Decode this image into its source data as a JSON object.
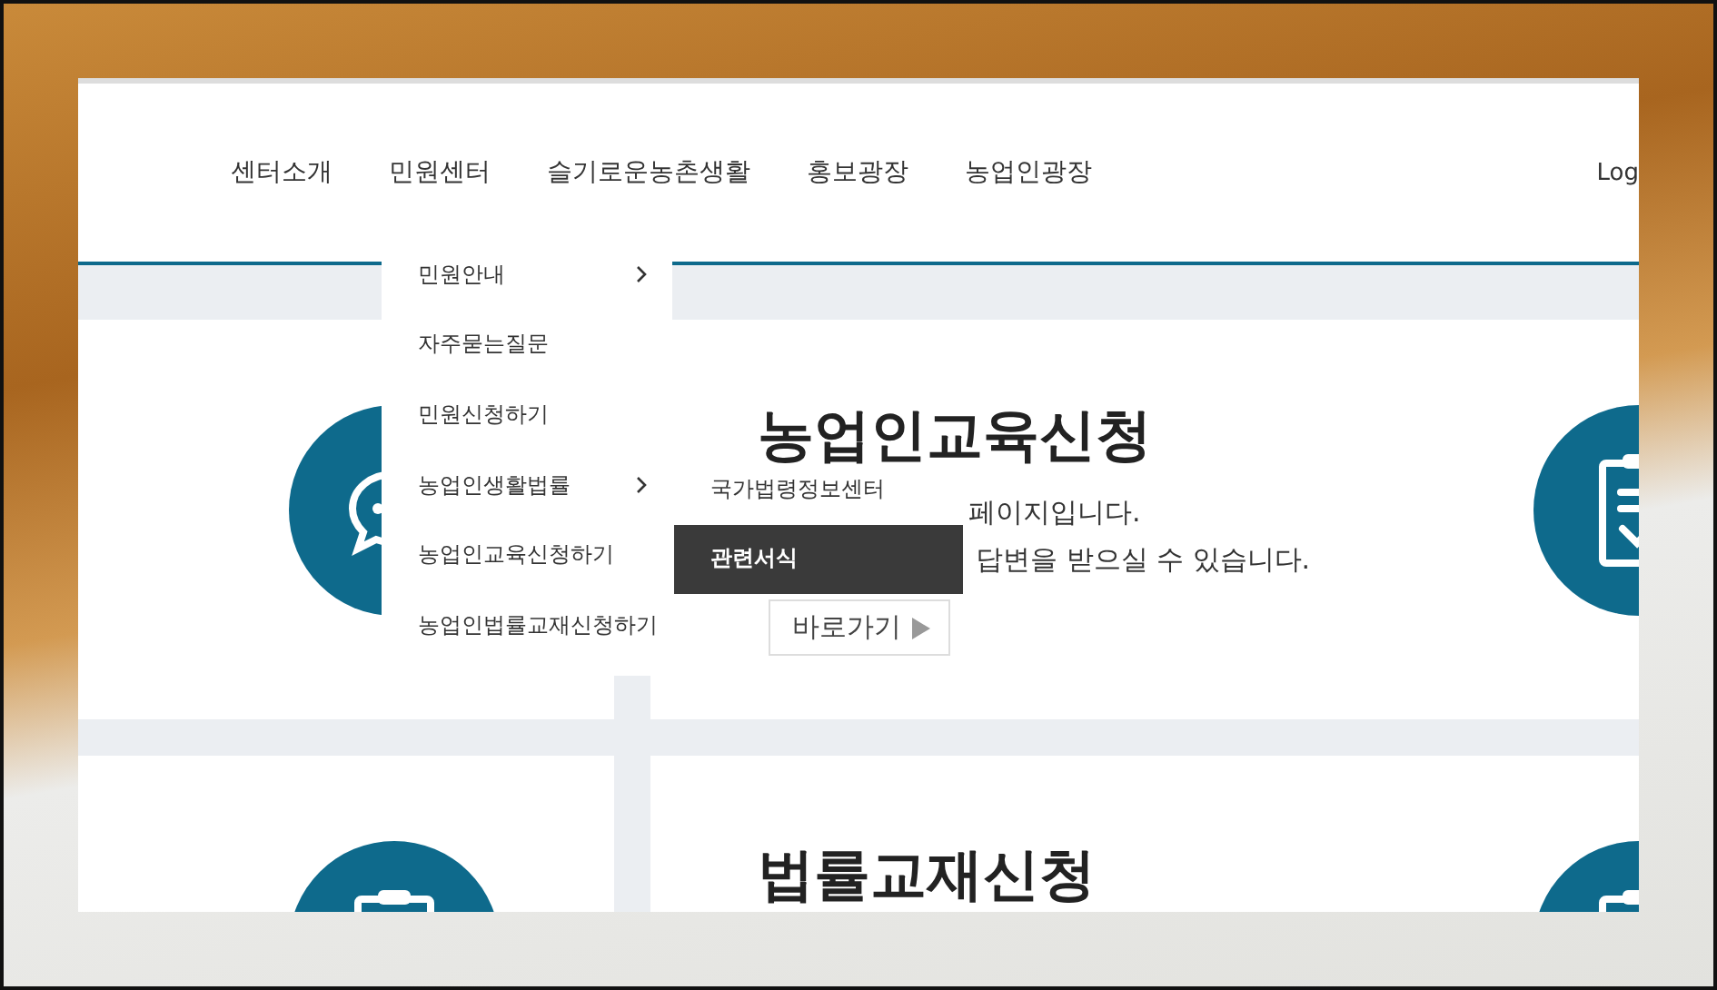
{
  "nav": {
    "items": [
      {
        "label": "센터소개"
      },
      {
        "label": "민원센터"
      },
      {
        "label": "슬기로운농촌생활"
      },
      {
        "label": "홍보광장"
      },
      {
        "label": "농업인광장"
      }
    ],
    "login": "Log"
  },
  "dropdown": {
    "items": [
      {
        "label": "민원안내",
        "has_submenu": true
      },
      {
        "label": "자주묻는질문",
        "has_submenu": false
      },
      {
        "label": "민원신청하기",
        "has_submenu": false
      },
      {
        "label": "농업인생활법률",
        "has_submenu": true
      },
      {
        "label": "농업인교육신청하기",
        "has_submenu": false
      },
      {
        "label": "농업인법률교재신청하기",
        "has_submenu": false
      }
    ]
  },
  "submenu": {
    "items": [
      {
        "label": "국가법령정보센터",
        "selected": false
      },
      {
        "label": "관련서식",
        "selected": true
      }
    ]
  },
  "cards": [
    {
      "title": "농업인교육신청",
      "lines": [
        "페이지입니다.",
        "답변을 받으실 수 있습니다."
      ],
      "button": "바로가기"
    },
    {
      "title": "법률교재신청"
    }
  ]
}
